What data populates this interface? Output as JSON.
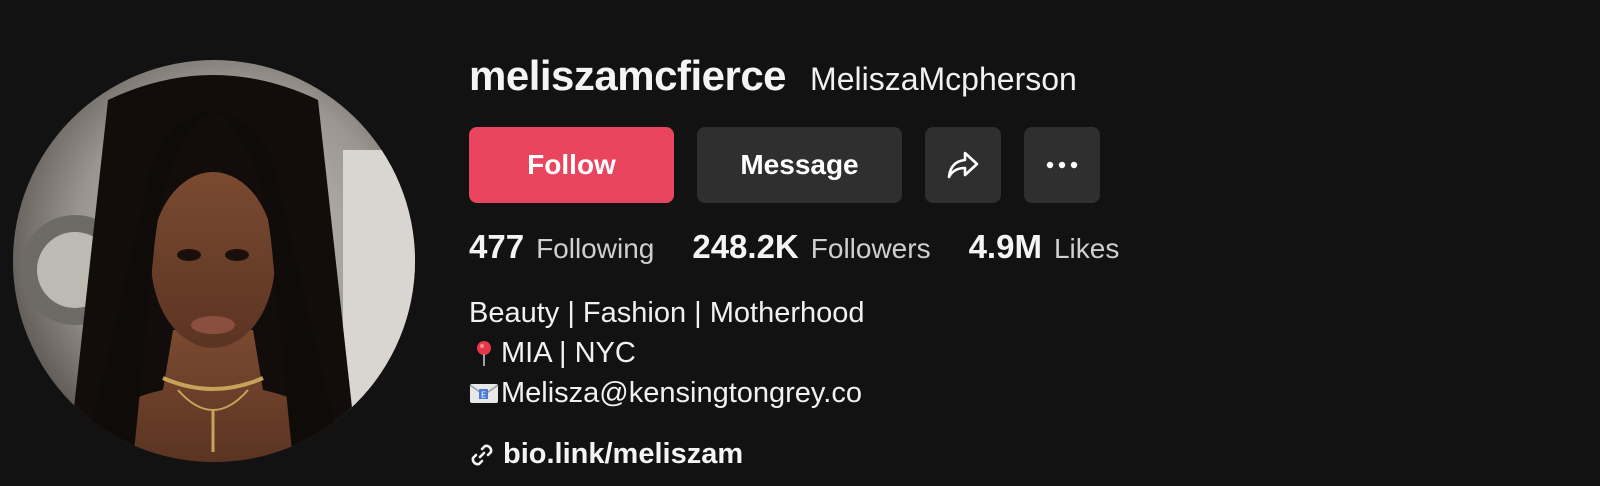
{
  "profile": {
    "username": "meliszamcfierce",
    "display_name": "MeliszaMcpherson",
    "avatar_alt": "profile-photo"
  },
  "actions": {
    "follow_label": "Follow",
    "message_label": "Message",
    "share_icon": "share-arrow-icon",
    "more_icon": "more-dots-icon"
  },
  "stats": {
    "following": {
      "value": "477",
      "label": "Following"
    },
    "followers": {
      "value": "248.2K",
      "label": "Followers"
    },
    "likes": {
      "value": "4.9M",
      "label": "Likes"
    }
  },
  "bio": {
    "line1": "Beauty | Fashion | Motherhood",
    "line2": "MIA | NYC",
    "line3": "Melisza@kensingtongrey.co",
    "line2_icon": "pin-icon",
    "line3_icon": "email-icon"
  },
  "link": {
    "text": "bio.link/meliszam",
    "icon": "link-icon"
  },
  "colors": {
    "background": "#121212",
    "follow_button": "#e9455f",
    "secondary_button": "#2f2f2f",
    "primary_text": "#f1f1f2",
    "muted_text": "#cfcfd1"
  }
}
